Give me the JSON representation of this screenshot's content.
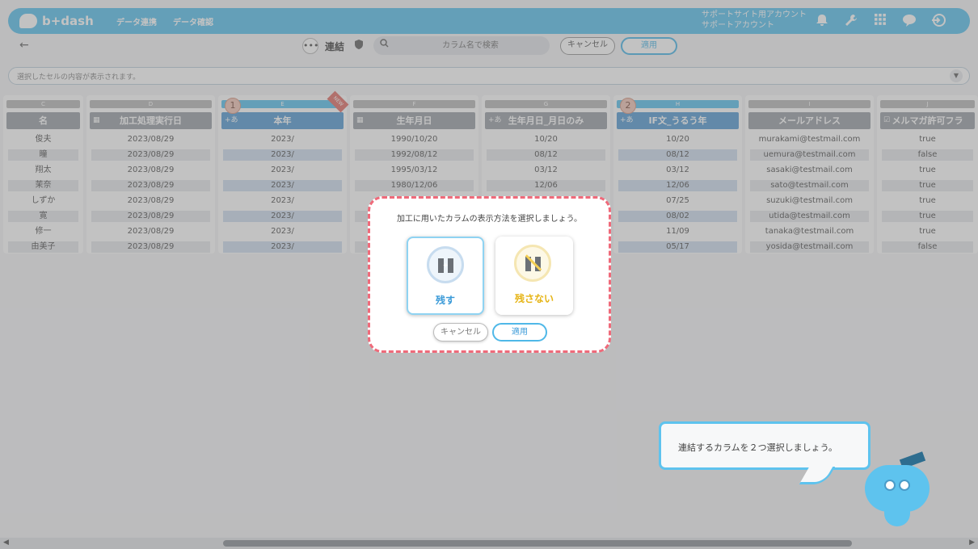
{
  "header": {
    "logo_text": "b+dash",
    "nav": [
      "データ連携",
      "データ確認"
    ],
    "account_line1": "サポートサイト用アカウント",
    "account_line2": "サポートアカウント"
  },
  "toolbar": {
    "back": "←",
    "more": "•••",
    "mode_label": "連結",
    "search_placeholder": "カラム名で検索",
    "cancel": "キャンセル",
    "apply": "適用"
  },
  "cell_bar": {
    "text": "選択したセルの内容が表示されます。"
  },
  "columns": [
    {
      "letter": "C",
      "header": "名",
      "cells": [
        "俊夫",
        "瞳",
        "翔太",
        "茉奈",
        "しずか",
        "寛",
        "修一",
        "由美子"
      ]
    },
    {
      "letter": "D",
      "header": "加工処理実行日",
      "cells": [
        "2023/08/29",
        "2023/08/29",
        "2023/08/29",
        "2023/08/29",
        "2023/08/29",
        "2023/08/29",
        "2023/08/29",
        "2023/08/29"
      ]
    },
    {
      "letter": "E",
      "header": "本年",
      "selected": true,
      "order": "1",
      "new_tag": "NEW",
      "cells": [
        "2023/",
        "2023/",
        "2023/",
        "2023/",
        "2023/",
        "2023/",
        "2023/",
        "2023/"
      ]
    },
    {
      "letter": "F",
      "header": "生年月日",
      "cells": [
        "1990/10/20",
        "1992/08/12",
        "1995/03/12",
        "1980/12/06",
        "",
        "",
        "",
        ""
      ]
    },
    {
      "letter": "G",
      "header": "生年月日_月日のみ",
      "cells": [
        "10/20",
        "08/12",
        "03/12",
        "12/06",
        "",
        "",
        "",
        ""
      ]
    },
    {
      "letter": "H",
      "header": "IF文_うるう年",
      "selected": true,
      "order": "2",
      "cells": [
        "10/20",
        "08/12",
        "03/12",
        "12/06",
        "07/25",
        "08/02",
        "11/09",
        "05/17"
      ]
    },
    {
      "letter": "I",
      "header": "メールアドレス",
      "cells": [
        "murakami@testmail.com",
        "uemura@testmail.com",
        "sasaki@testmail.com",
        "sato@testmail.com",
        "suzuki@testmail.com",
        "utida@testmail.com",
        "tanaka@testmail.com",
        "yosida@testmail.com"
      ]
    },
    {
      "letter": "J",
      "header": "メルマガ許可フラ",
      "cells": [
        "true",
        "false",
        "true",
        "true",
        "true",
        "true",
        "true",
        "false"
      ]
    }
  ],
  "modal": {
    "message": "加工に用いたカラムの表示方法を選択しましょう。",
    "keep_label": "残す",
    "drop_label": "残さない",
    "cancel": "キャンセル",
    "apply": "適用"
  },
  "tooltip": {
    "text": "連結するカラムを２つ選択しましょう。"
  },
  "icons": {
    "bell": "bell-icon",
    "wrench": "wrench-icon",
    "grid": "grid-icon",
    "chat": "chat-icon",
    "logout": "logout-icon"
  },
  "colors": {
    "accent": "#5ec3ee",
    "highlight": "#ef6a7a"
  }
}
